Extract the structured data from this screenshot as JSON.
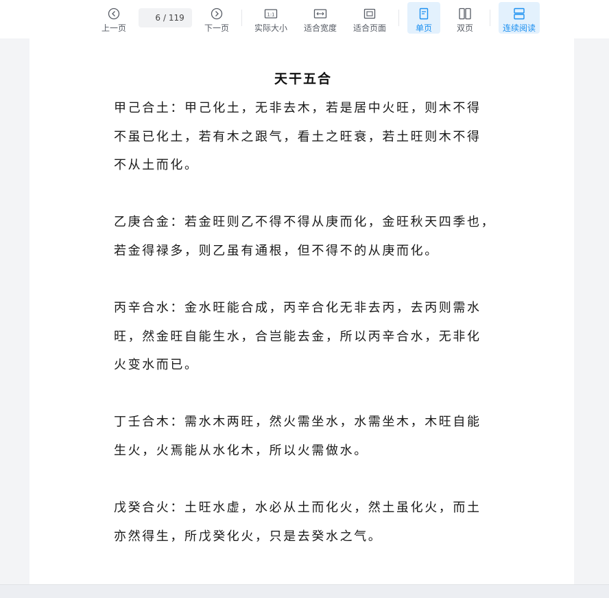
{
  "toolbar": {
    "prev_label": "上一页",
    "next_label": "下一页",
    "current_page": "6",
    "total_pages": "/ 119",
    "actual_size_label": "实际大小",
    "fit_width_label": "适合宽度",
    "fit_page_label": "适合页面",
    "single_page_label": "单页",
    "double_page_label": "双页",
    "continuous_label": "连续阅读",
    "accent_color": "#1b8ff0"
  },
  "document": {
    "title": "天干五合",
    "paragraphs": [
      {
        "lines": [
          "甲己合土：甲己化土，无非去木，若是居中火旺，则木不得",
          "不虽已化土，若有木之跟气，看土之旺衰，若土旺则木不得",
          "不从土而化。"
        ]
      },
      {
        "lines": [
          "乙庚合金：若金旺则乙不得不得从庚而化，金旺秋天四季也，",
          "若金得禄多，则乙虽有通根，但不得不的从庚而化。"
        ]
      },
      {
        "lines": [
          "丙辛合水：金水旺能合成，丙辛合化无非去丙，去丙则需水",
          "旺，然金旺自能生水，合岂能去金，所以丙辛合水，无非化",
          "火变水而已。"
        ]
      },
      {
        "lines": [
          "丁壬合木：需水木两旺，然火需坐水，水需坐木，木旺自能",
          "生火，火焉能从水化木，所以火需做水。"
        ]
      },
      {
        "lines": [
          "戊癸合火：土旺水虚，水必从土而化火，然土虽化火，而土",
          "亦然得生，所戊癸化火，只是去癸水之气。"
        ]
      }
    ]
  }
}
